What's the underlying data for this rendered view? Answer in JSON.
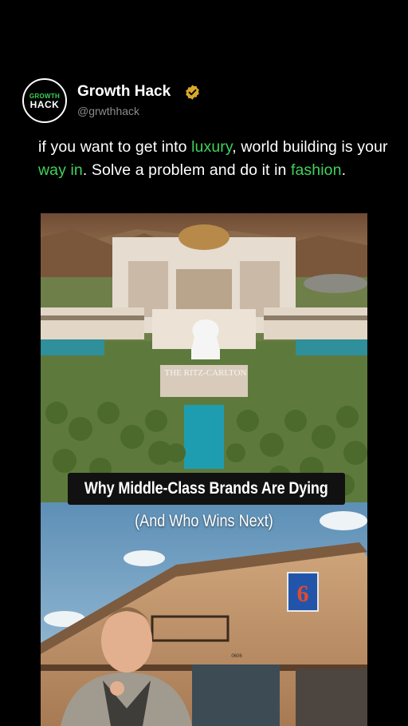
{
  "account": {
    "avatar_line1": "GROWTH",
    "avatar_line2": "HACK",
    "name": "Growth Hack",
    "handle": "@grwthhack",
    "verified_icon": "verified-badge-icon",
    "verified_color": "#d9a82b"
  },
  "caption": {
    "part1": "if you want to get into ",
    "hl1": "luxury",
    "part2": ", world building is your ",
    "hl2": "way in",
    "part3": ". Solve a problem and do it in ",
    "hl3": "fashion",
    "part4": ".",
    "highlight_color": "#3fd25b"
  },
  "media": {
    "hotel_logo_text": "THE RITZ-CARLTON",
    "title": "Why Middle-Class Brands Are Dying",
    "subtitle": "(And Who Wins Next)",
    "motel_sign": "6",
    "motel_room": "0606"
  }
}
